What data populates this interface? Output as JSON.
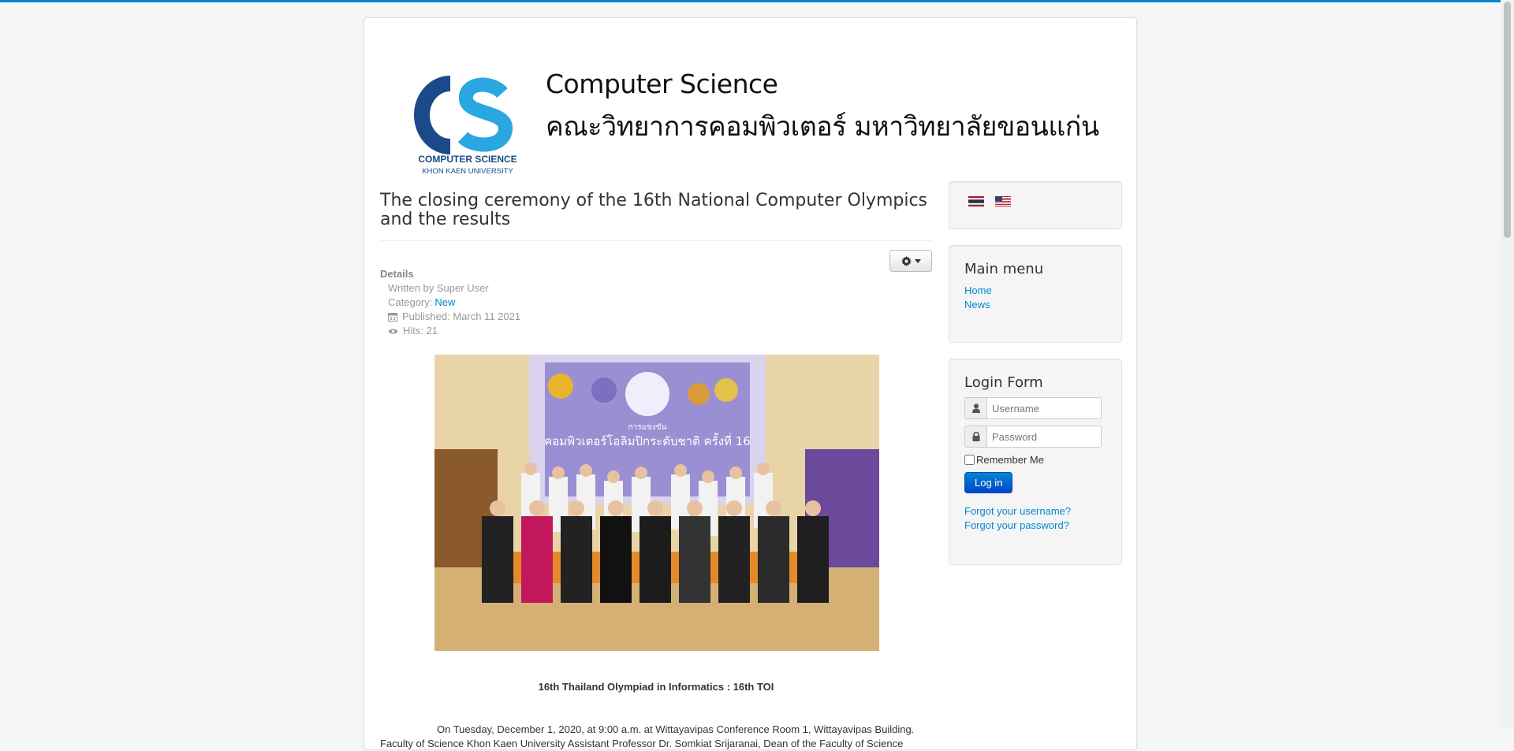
{
  "header": {
    "logo_text_line1": "COMPUTER SCIENCE",
    "logo_text_line2": "KHON KAEN UNIVERSITY",
    "title": "Computer Science",
    "subtitle": "คณะวิทยาการคอมพิวเตอร์ มหาวิทยาลัยขอนแก่น"
  },
  "article": {
    "title": "The closing ceremony of the 16th National Computer Olympics and the results",
    "details_label": "Details",
    "written_by": "Written by Super User",
    "category_label": "Category:",
    "category": "New",
    "published": "Published: March 11 2021",
    "hits": "Hits: 21",
    "photo_banner_line1": "การแข่งขัน",
    "photo_banner_line2": "คอมพิวเตอร์โอลิมปิกระดับชาติ ครั้งที่ 16",
    "caption": "16th Thailand Olympiad in Informatics : 16th TOI",
    "body": "On Tuesday, December 1, 2020, at 9:00 a.m. at Wittayavipas Conference Room 1, Wittayavipas Building. Faculty of Science Khon Kaen University Assistant Professor Dr. Somkiat Srijaranai, Dean of the Faculty of Science"
  },
  "sidebar": {
    "languages": [
      "th",
      "en"
    ],
    "main_menu": {
      "title": "Main menu",
      "items": [
        "Home",
        "News"
      ]
    },
    "login": {
      "title": "Login Form",
      "username_placeholder": "Username",
      "password_placeholder": "Password",
      "remember_label": "Remember Me",
      "submit_label": "Log in",
      "forgot_username": "Forgot your username?",
      "forgot_password": "Forgot your password?"
    }
  },
  "colors": {
    "accent": "#0088cc",
    "logo_dark": "#1b4a8a",
    "logo_light": "#2aa7e0"
  }
}
